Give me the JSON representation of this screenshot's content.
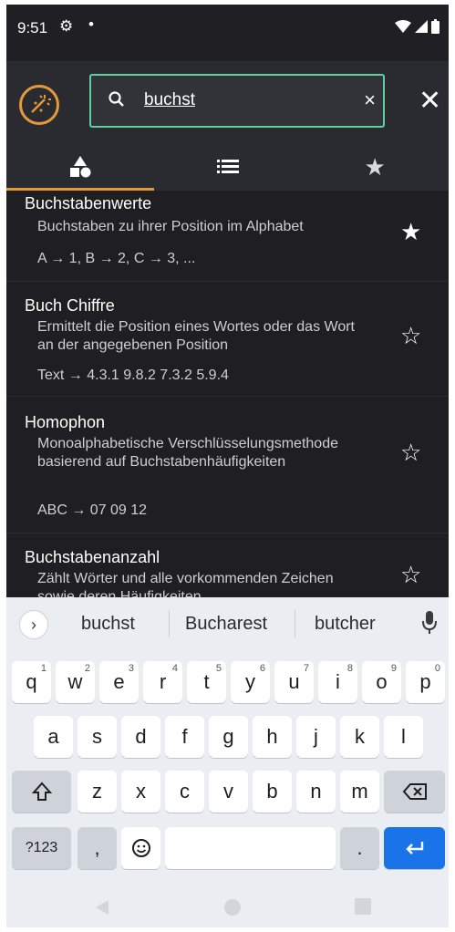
{
  "status": {
    "time": "9:51",
    "gear_icon": "gear-icon",
    "dot": "•"
  },
  "search": {
    "query": "buchst",
    "clear": "×",
    "close": "✕"
  },
  "tabs": [
    {
      "icon": "shapes-icon",
      "active": true
    },
    {
      "icon": "list-icon",
      "active": false
    },
    {
      "icon": "star-icon",
      "active": false
    }
  ],
  "items": [
    {
      "title": "Buchstabenwerte",
      "desc": "Buchstaben zu ihrer Position im Alphabet",
      "example": "A → 1, B → 2, C → 3, ...",
      "favorite": true
    },
    {
      "title": "Buch Chiffre",
      "desc": "Ermittelt die Position eines Wortes oder das Wort an der angegebenen Position",
      "example": "Text → 4.3.1 9.8.2 7.3.2 5.9.4",
      "favorite": false
    },
    {
      "title": "Homophon",
      "desc": "Monoalphabetische Verschlüsselungsmethode basierend auf Buchstabenhäufigkeiten",
      "example": "ABC → 07 09 12",
      "favorite": false
    },
    {
      "title": "Buchstabenanzahl",
      "desc": "Zählt Wörter und alle vorkommenden Zeichen sowie deren Häufigkeiten",
      "example": "",
      "favorite": false
    }
  ],
  "keyboard": {
    "suggestions": [
      "buchst",
      "Bucharest",
      "butcher"
    ],
    "row1": [
      [
        "q",
        "1"
      ],
      [
        "w",
        "2"
      ],
      [
        "e",
        "3"
      ],
      [
        "r",
        "4"
      ],
      [
        "t",
        "5"
      ],
      [
        "y",
        "6"
      ],
      [
        "u",
        "7"
      ],
      [
        "i",
        "8"
      ],
      [
        "o",
        "9"
      ],
      [
        "p",
        "0"
      ]
    ],
    "row2": [
      "a",
      "s",
      "d",
      "f",
      "g",
      "h",
      "j",
      "k",
      "l"
    ],
    "row3": [
      "z",
      "x",
      "c",
      "v",
      "b",
      "n",
      "m"
    ],
    "mode_key": "?123",
    "comma": ",",
    "period": "."
  },
  "colors": {
    "accent": "#e39b3a",
    "search_border": "#5ecfa0",
    "enter": "#1a73e8"
  }
}
